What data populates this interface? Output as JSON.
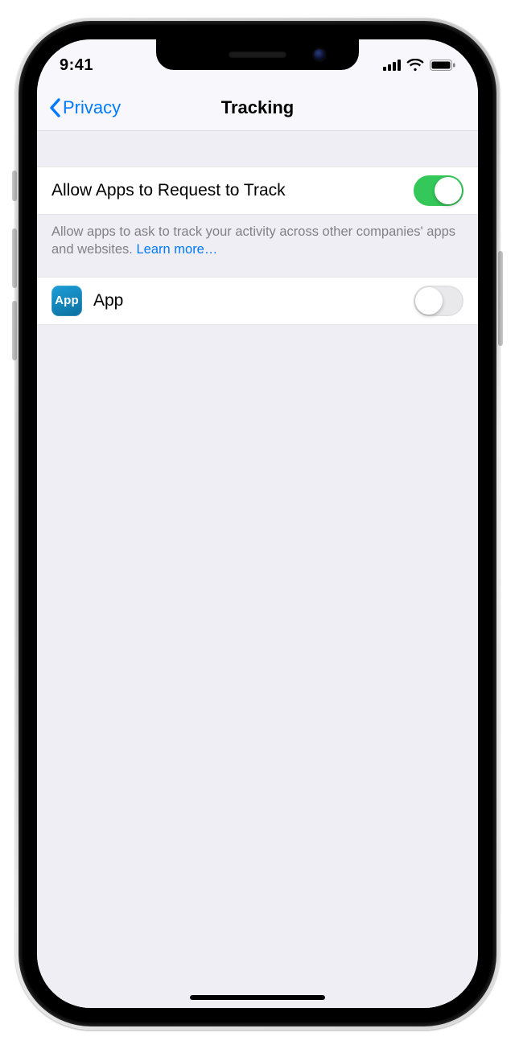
{
  "status": {
    "time": "9:41"
  },
  "nav": {
    "back_label": "Privacy",
    "title": "Tracking"
  },
  "sections": {
    "allow": {
      "label": "Allow Apps to Request to Track",
      "enabled": true,
      "footer_text": "Allow apps to ask to track your activity across other companies' apps and websites. ",
      "footer_link": "Learn more…"
    },
    "apps": [
      {
        "icon_text": "App",
        "name": "App",
        "enabled": false
      }
    ]
  },
  "colors": {
    "tint": "#007aff",
    "toggle_on": "#34c759"
  }
}
